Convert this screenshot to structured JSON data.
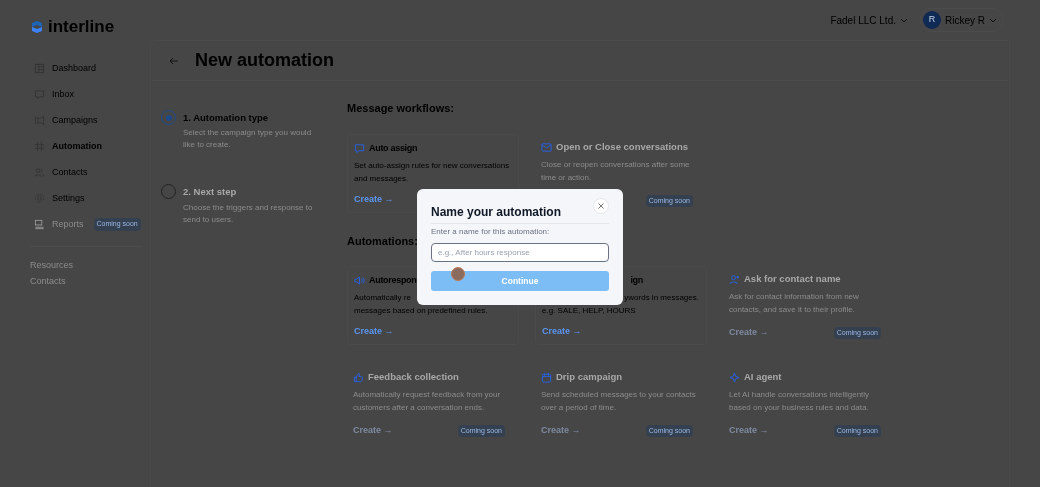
{
  "brand": {
    "name": "interline"
  },
  "top_bar": {
    "org": "Fadel LLC Ltd.",
    "user": {
      "initial": "R",
      "name": "Rickey R"
    }
  },
  "sidebar": {
    "items": [
      {
        "label": "Dashboard",
        "selected": false,
        "disabled": false
      },
      {
        "label": "Inbox",
        "selected": false,
        "disabled": false
      },
      {
        "label": "Campaigns",
        "selected": false,
        "disabled": false
      },
      {
        "label": "Automation",
        "selected": true,
        "disabled": false
      },
      {
        "label": "Contacts",
        "selected": false,
        "disabled": false
      },
      {
        "label": "Settings",
        "selected": false,
        "disabled": false
      },
      {
        "label": "Reports",
        "selected": false,
        "disabled": true,
        "badge": "Coming soon"
      }
    ],
    "links": [
      "Resources",
      "Contacts"
    ]
  },
  "page": {
    "title": "New automation"
  },
  "steps": [
    {
      "title": "1. Automation type",
      "description": "Select the campaign type you would like to create.",
      "selected": true
    },
    {
      "title": "2. Next step",
      "description": "Choose the triggers and response to send to users.",
      "selected": false
    }
  ],
  "sections": [
    {
      "heading": "Message workflows:",
      "cards": [
        {
          "kind": "full",
          "title": "Auto assign",
          "lines": [
            "Set auto-assign rules for new conversations",
            "and messages."
          ],
          "action": "Create →",
          "available": true
        },
        {
          "kind": "full",
          "title": "Open or Close conversations",
          "lines": [
            "Close or reopen conversations after some",
            "time or action."
          ],
          "available": false,
          "badge": "Coming soon"
        }
      ]
    },
    {
      "heading": "Automations:",
      "cards": [
        {
          "kind": "full",
          "title": "Autorespon",
          "lines": [
            "Automatically re",
            "messages based on predefined rules."
          ],
          "action": "Create →",
          "available": true
        },
        {
          "kind": "covered",
          "title": "ign",
          "lines": [
            "ywords in messages.",
            "e.g. SALE, HELP, HOURS"
          ],
          "action": "Create →",
          "available": true
        },
        {
          "kind": "full",
          "title": "Ask for contact name",
          "lines": [
            "Ask for contact information from new",
            "contacts, and save it to their profile."
          ],
          "action": "Create →",
          "available": false,
          "badge": "Coming soon"
        },
        {
          "kind": "full",
          "title": "Feedback collection",
          "lines": [
            "Automatically request feedback from your",
            "customers after a conversation ends."
          ],
          "action": "Create →",
          "available": false,
          "badge": "Coming soon"
        },
        {
          "kind": "full",
          "title": "Drip campaign",
          "lines": [
            "Send scheduled messages to your contacts",
            "over a period of time."
          ],
          "action": "Create →",
          "available": false,
          "badge": "Coming soon"
        },
        {
          "kind": "full",
          "title": "AI agent",
          "lines": [
            "Let AI handle conversations intelligently",
            "based on your business rules and data."
          ],
          "action": "Create →",
          "available": false,
          "badge": "Coming soon"
        }
      ]
    }
  ],
  "modal": {
    "title": "Name your automation",
    "label": "Enter a name for this automation:",
    "placeholder": "e.g., After hours response",
    "button": {
      "label": "Continue",
      "disabled": true
    }
  }
}
